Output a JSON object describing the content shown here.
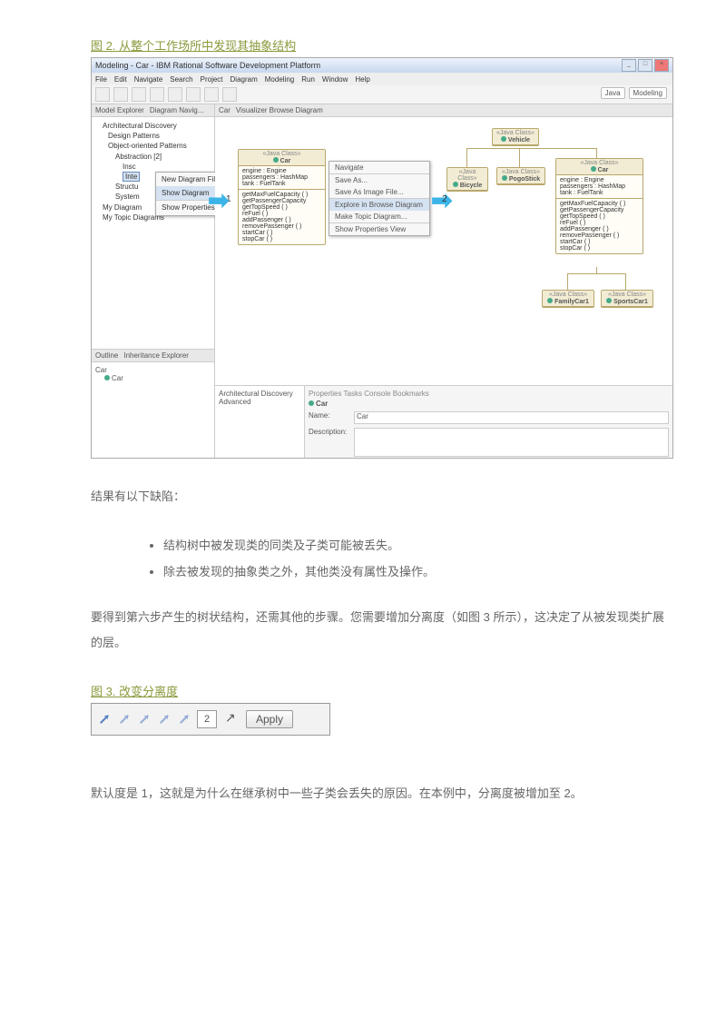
{
  "figure2": {
    "caption": "图 2. 从整个工作场所中发现其抽象结构",
    "window_title": "Modeling - Car - IBM Rational Software Development Platform",
    "menus": [
      "File",
      "Edit",
      "Navigate",
      "Search",
      "Project",
      "Diagram",
      "Modeling",
      "Run",
      "Window",
      "Help"
    ],
    "perspectives": {
      "p1": "Java",
      "p2": "Modeling"
    },
    "left_tabs": {
      "t1": "Model Explorer",
      "t2": "Diagram Navig..."
    },
    "tree": {
      "root": "Architectural Discovery",
      "n1": "Design Patterns",
      "n2": "Object-oriented Patterns",
      "n3": "Abstraction [2]",
      "n4": "Insc",
      "n5": "Inte",
      "n6": "Structu",
      "n7": "System",
      "n8": "My Diagram",
      "n9": "My Topic Diagrams",
      "sel": "Inte",
      "ctx1": "New Diagram File",
      "ctx2": "Show Diagram",
      "ctx3": "Show Properties View"
    },
    "outline_tabs": {
      "t1": "Outline",
      "t2": "Inheritance Explorer"
    },
    "outline_root": "Car",
    "outline_child": "Car",
    "editor_tabs": {
      "t1": "Car",
      "t2": "Visualizer Browse Diagram"
    },
    "car_class": {
      "stereo": "«Java Class»",
      "name": "Car",
      "attrs": [
        "engine : Engine",
        "passengers : HashMap",
        "tank : FuelTank"
      ],
      "ops": [
        "getMaxFuelCapacity ( )",
        "getPassengerCapacity",
        "getTopSpeed ( )",
        "reFuel ( )",
        "addPassenger ( )",
        "removePassenger ( )",
        "startCar ( )",
        "stopCar ( )"
      ]
    },
    "ctx_menu2": {
      "i1": "Navigate",
      "i2": "Save As...",
      "i3": "Save As Image File...",
      "i4": "Explore in Browse Diagram",
      "i5": "Make Topic Diagram...",
      "i6": "Show Properties View"
    },
    "step1": "1",
    "step2": "2",
    "vehicle": {
      "stereo": "«Java Class»",
      "name": "Vehicle"
    },
    "bicycle": {
      "stereo": "«Java Class»",
      "name": "Bicycle"
    },
    "pogo": {
      "stereo": "«Java Class»",
      "name": "PogoStick"
    },
    "car2": {
      "stereo": "«Java Class»",
      "name": "Car"
    },
    "family": {
      "stereo": "«Java Class»",
      "name": "FamilyCar1"
    },
    "sports": {
      "stereo": "«Java Class»",
      "name": "SportsCar1"
    },
    "bottom_tabs": "Properties  Tasks  Console  Bookmarks",
    "bp_left": {
      "i1": "Architectural Discovery",
      "i2": "Advanced"
    },
    "bp_title": "Car",
    "bp_name_label": "Name:",
    "bp_name_value": "Car",
    "bp_desc_label": "Description:"
  },
  "para1": "结果有以下缺陷：",
  "li1": "结构树中被发现类的同类及子类可能被丢失。",
  "li2": "除去被发现的抽象类之外，其他类没有属性及操作。",
  "para2": "要得到第六步产生的树状结构，还需其他的步骤。您需要增加分离度（如图 3 所示），这决定了从被发现类扩展的层。",
  "figure3": {
    "caption": "图 3. 改变分离度",
    "value": "2",
    "apply": "Apply"
  },
  "para3": "默认度是 1，这就是为什么在继承树中一些子类会丢失的原因。在本例中，分离度被增加至 2。"
}
